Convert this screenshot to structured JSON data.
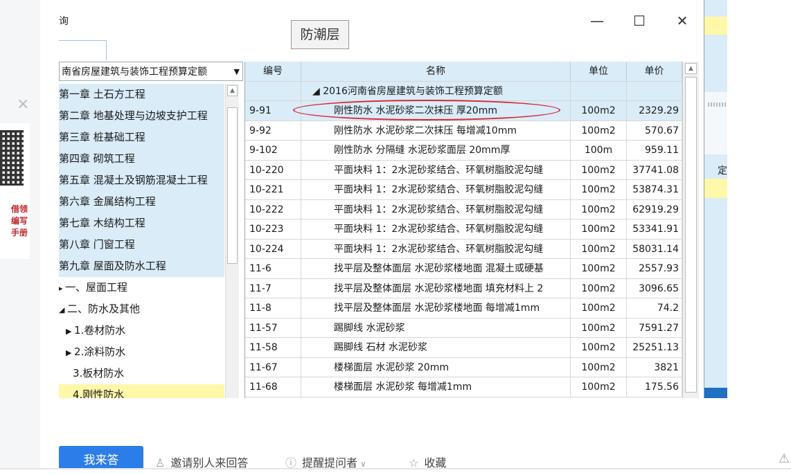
{
  "left_panel": {
    "close_glyph": "×",
    "promo_lines": [
      "借领",
      "编写",
      "手册"
    ]
  },
  "background": {
    "fragment_text": "定"
  },
  "dialog": {
    "title_fragment": "询",
    "search_value": "防潮层",
    "window_buttons": {
      "minimize": "—",
      "maximize": "☐",
      "close": "✕"
    },
    "chapter_select": {
      "value": "南省房屋建筑与装饰工程预算定额",
      "arrow": "▼"
    },
    "tree": [
      {
        "label": "第一章 土石方工程",
        "style": "blue"
      },
      {
        "label": "第二章 地基处理与边坡支护工程",
        "style": "blue"
      },
      {
        "label": "第三章 桩基础工程",
        "style": "blue"
      },
      {
        "label": "第四章 砌筑工程",
        "style": "blue"
      },
      {
        "label": "第五章 混凝土及钢筋混凝土工程",
        "style": "blue"
      },
      {
        "label": "第六章 金属结构工程",
        "style": "blue"
      },
      {
        "label": "第七章 木结构工程",
        "style": "blue"
      },
      {
        "label": "第八章 门窗工程",
        "style": "blue"
      },
      {
        "label": "第九章 屋面及防水工程",
        "style": "blue"
      },
      {
        "label": "一、屋面工程",
        "style": "white",
        "prefix": "▸ ",
        "indent": 0
      },
      {
        "label": "二、防水及其他",
        "style": "white",
        "prefix": "◢ ",
        "indent": 0
      },
      {
        "label": "1.卷材防水",
        "style": "white",
        "prefix": "▶ ",
        "indent": 10
      },
      {
        "label": "2.涂料防水",
        "style": "white",
        "prefix": "▶ ",
        "indent": 10
      },
      {
        "label": "3.板材防水",
        "style": "white",
        "prefix": "",
        "indent": 20
      },
      {
        "label": "4.刚性防水",
        "style": "yellow",
        "prefix": "",
        "indent": 20
      }
    ],
    "table": {
      "columns": [
        "编号",
        "名称",
        "单位",
        "单价"
      ],
      "group_row": "◢ 2016河南省房屋建筑与装饰工程预算定额",
      "rows": [
        {
          "code": "9-91",
          "name": "刚性防水 水泥砂浆二次抹压 厚20mm",
          "unit": "100m2",
          "price": "2329.29",
          "selected": true
        },
        {
          "code": "9-92",
          "name": "刚性防水 水泥砂浆二次抹压 每增减10mm",
          "unit": "100m2",
          "price": "570.67"
        },
        {
          "code": "9-102",
          "name": "刚性防水 分隔缝 水泥砂浆面层 20mm厚",
          "unit": "100m",
          "price": "959.11"
        },
        {
          "code": "10-220",
          "name": "平面块料 1：2水泥砂浆结合、环氧树脂胶泥勾缝",
          "unit": "100m2",
          "price": "37741.08"
        },
        {
          "code": "10-221",
          "name": "平面块料 1：2水泥砂浆结合、环氧树脂胶泥勾缝",
          "unit": "100m2",
          "price": "53874.31"
        },
        {
          "code": "10-222",
          "name": "平面块料 1：2水泥砂浆结合、环氧树脂胶泥勾缝",
          "unit": "100m2",
          "price": "62919.29"
        },
        {
          "code": "10-223",
          "name": "平面块料 1：2水泥砂浆结合、环氧树脂胶泥勾缝",
          "unit": "100m2",
          "price": "53341.91"
        },
        {
          "code": "10-224",
          "name": "平面块料 1：2水泥砂浆结合、环氧树脂胶泥勾缝",
          "unit": "100m2",
          "price": "58031.14"
        },
        {
          "code": "11-6",
          "name": "找平层及整体面层 水泥砂浆楼地面 混凝土或硬基",
          "unit": "100m2",
          "price": "2557.93"
        },
        {
          "code": "11-7",
          "name": "找平层及整体面层 水泥砂浆楼地面 填充材料上 2",
          "unit": "100m2",
          "price": "3096.65"
        },
        {
          "code": "11-8",
          "name": "找平层及整体面层 水泥砂浆楼地面 每增减1mm",
          "unit": "100m2",
          "price": "74.2"
        },
        {
          "code": "11-57",
          "name": "踢脚线 水泥砂浆",
          "unit": "100m2",
          "price": "7591.27"
        },
        {
          "code": "11-58",
          "name": "踢脚线 石材 水泥砂浆",
          "unit": "100m2",
          "price": "25251.13"
        },
        {
          "code": "11-67",
          "name": "楼梯面层 水泥砂浆 20mm",
          "unit": "100m2",
          "price": "3821"
        },
        {
          "code": "11-68",
          "name": "楼梯面层 水泥砂浆 每增减1mm",
          "unit": "100m2",
          "price": "175.56"
        }
      ]
    }
  },
  "bottom_bar": {
    "answer_button": "我来答",
    "invite": "邀请别人来回答",
    "remind": "提醒提问者",
    "favorite": "收藏",
    "invite_icon": "person-icon",
    "remind_icon": "info-icon",
    "favorite_icon": "star-icon",
    "accent_color": "#2b7de9"
  }
}
